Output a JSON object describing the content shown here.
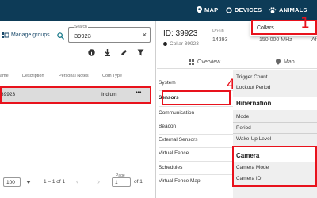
{
  "nav": {
    "map": "MAP",
    "devices": "DEVICES",
    "animals": "ANIMALS"
  },
  "dropdown": {
    "collars": "Collars"
  },
  "annotations": {
    "one": "1",
    "four": "4"
  },
  "left_panel": {
    "manage_groups": "Manage groups",
    "search": {
      "label": "Search",
      "value": "39923"
    },
    "columns": [
      "ame",
      "Description",
      "Personal Notes",
      "Com Type"
    ],
    "row": {
      "name": "39923",
      "com_type": "Iridium",
      "more": "•••"
    },
    "pagination": {
      "per_page": "100",
      "range": "1 – 1 of 1",
      "page_label": "Page",
      "page_value": "1",
      "of_text": "of 1"
    }
  },
  "detail": {
    "id_title": "ID: 39923",
    "collar_label": "Collar 39923",
    "position_label": "Positi",
    "position_value": "14393",
    "frequency": "150.000 MHz",
    "af": "Af",
    "tabs": {
      "overview": "Overview",
      "map": "Map"
    }
  },
  "settings_menu": {
    "system": "System",
    "sensors": "Sensors",
    "communication": "Communication",
    "beacon": "Beacon",
    "external_sensors": "External Sensors",
    "virtual_fence": "Virtual Fence",
    "schedules": "Schedules",
    "virtual_fence_map": "Virtual Fence Map"
  },
  "sensor_panel": {
    "trigger_count": "Trigger Count",
    "lockout_period": "Lockout Period",
    "hibernation": "Hibernation",
    "mode": "Mode",
    "period": "Period",
    "wake_up_level": "Wake-Up Level",
    "camera": "Camera",
    "camera_mode": "Camera Mode",
    "camera_id": "Camera ID"
  },
  "colors": {
    "topbar": "#0d3b57",
    "annotation": "#e8121c",
    "accent": "#1a6fa8"
  }
}
